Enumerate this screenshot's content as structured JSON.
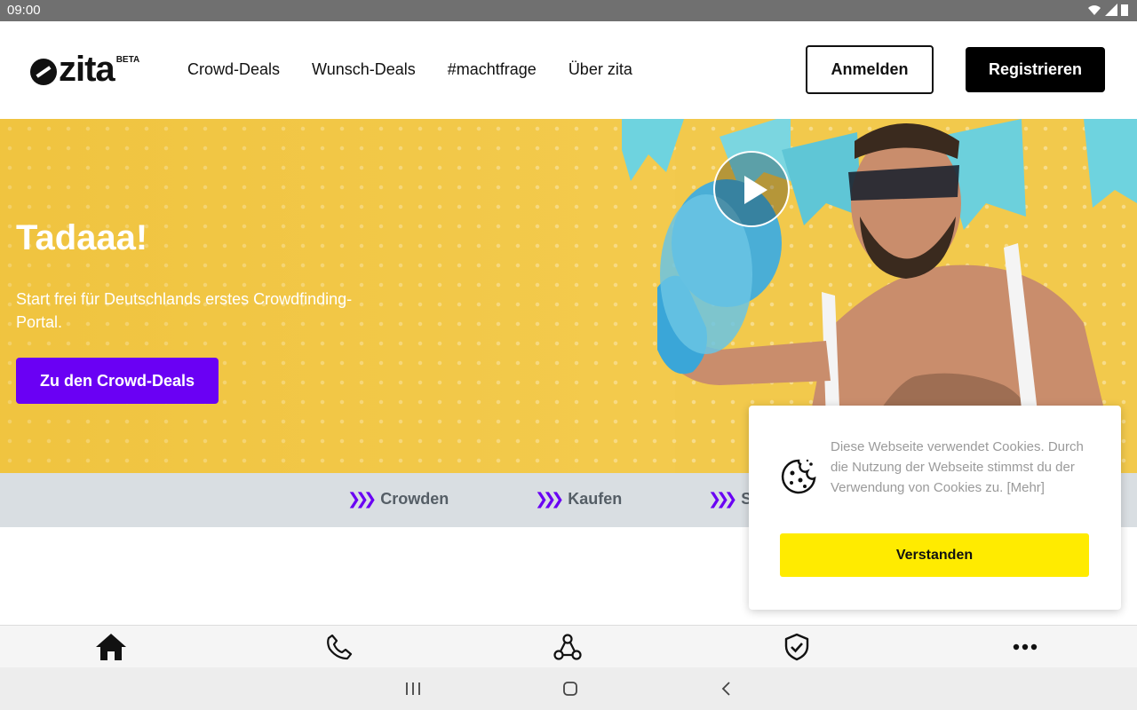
{
  "status": {
    "time": "09:00"
  },
  "header": {
    "logo_text": "zita",
    "logo_badge": "BETA",
    "nav": [
      "Crowd-Deals",
      "Wunsch-Deals",
      "#machtfrage",
      "Über zita"
    ],
    "login_label": "Anmelden",
    "register_label": "Registrieren"
  },
  "hero": {
    "title": "Tadaaa!",
    "subtitle": "Start frei für Deutschlands erstes Crowdfinding-Portal.",
    "cta_label": "Zu den Crowd-Deals",
    "background_color": "#f2c94c"
  },
  "features": [
    {
      "label": "Crowden",
      "icon": "triple-chevron-icon"
    },
    {
      "label": "Kaufen",
      "icon": "triple-chevron-icon"
    },
    {
      "label": "Sp",
      "icon": "triple-chevron-icon"
    }
  ],
  "cookie": {
    "text": "Diese Webseite verwendet Cookies. Durch die Nutzung der Webseite stimmst du der Verwendung von Cookies zu. [Mehr]",
    "button_label": "Verstanden",
    "icon": "cookie-icon"
  },
  "bottom_nav": [
    "home-icon",
    "phone-icon",
    "network-icon",
    "shield-check-icon",
    "more-icon"
  ],
  "system_nav": [
    "recents-icon",
    "home-button-icon",
    "back-icon"
  ],
  "colors": {
    "accent": "#6a00f4",
    "cookie_button": "#ffeb00",
    "strip": "#d9dee2"
  }
}
